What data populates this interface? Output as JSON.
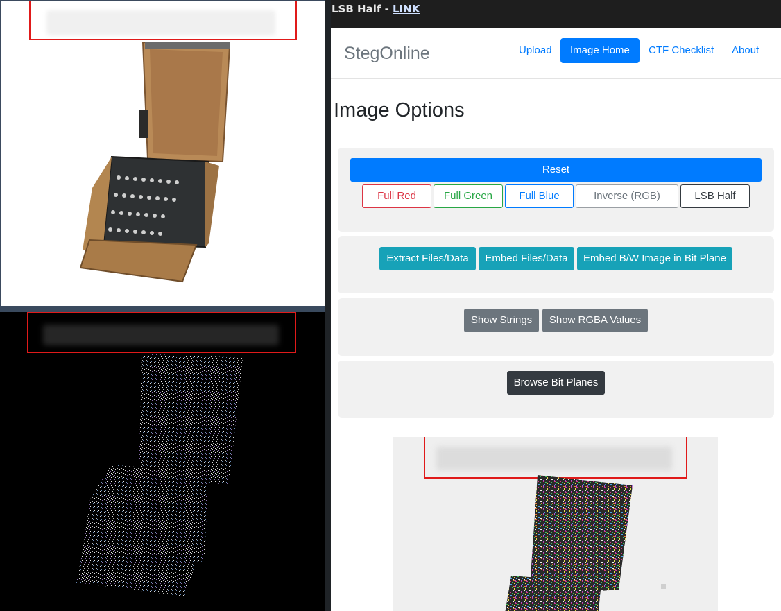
{
  "titlebar": {
    "prefix": "LSB Half - ",
    "link_text": "LINK"
  },
  "navbar": {
    "brand": "StegOnline",
    "links": [
      {
        "label": "Upload",
        "active": false
      },
      {
        "label": "Image Home",
        "active": true
      },
      {
        "label": "CTF Checklist",
        "active": false
      },
      {
        "label": "About",
        "active": false
      }
    ]
  },
  "page": {
    "title": "Image Options"
  },
  "panel1": {
    "reset": "Reset",
    "full_red": "Full Red",
    "full_green": "Full Green",
    "full_blue": "Full Blue",
    "inverse": "Inverse (RGB)",
    "lsb_half": "LSB Half"
  },
  "panel2": {
    "extract": "Extract Files/Data",
    "embed": "Embed Files/Data",
    "embed_bw": "Embed B/W Image in Bit Plane"
  },
  "panel3": {
    "show_strings": "Show Strings",
    "show_rgba": "Show RGBA Values"
  },
  "panel4": {
    "browse": "Browse Bit Planes"
  },
  "colors": {
    "primary": "#007bff",
    "danger": "#dc3545",
    "success": "#28a745",
    "info": "#17a2b8",
    "secondary": "#6c757d",
    "dark": "#343a40",
    "redact": "#e01a1a"
  }
}
